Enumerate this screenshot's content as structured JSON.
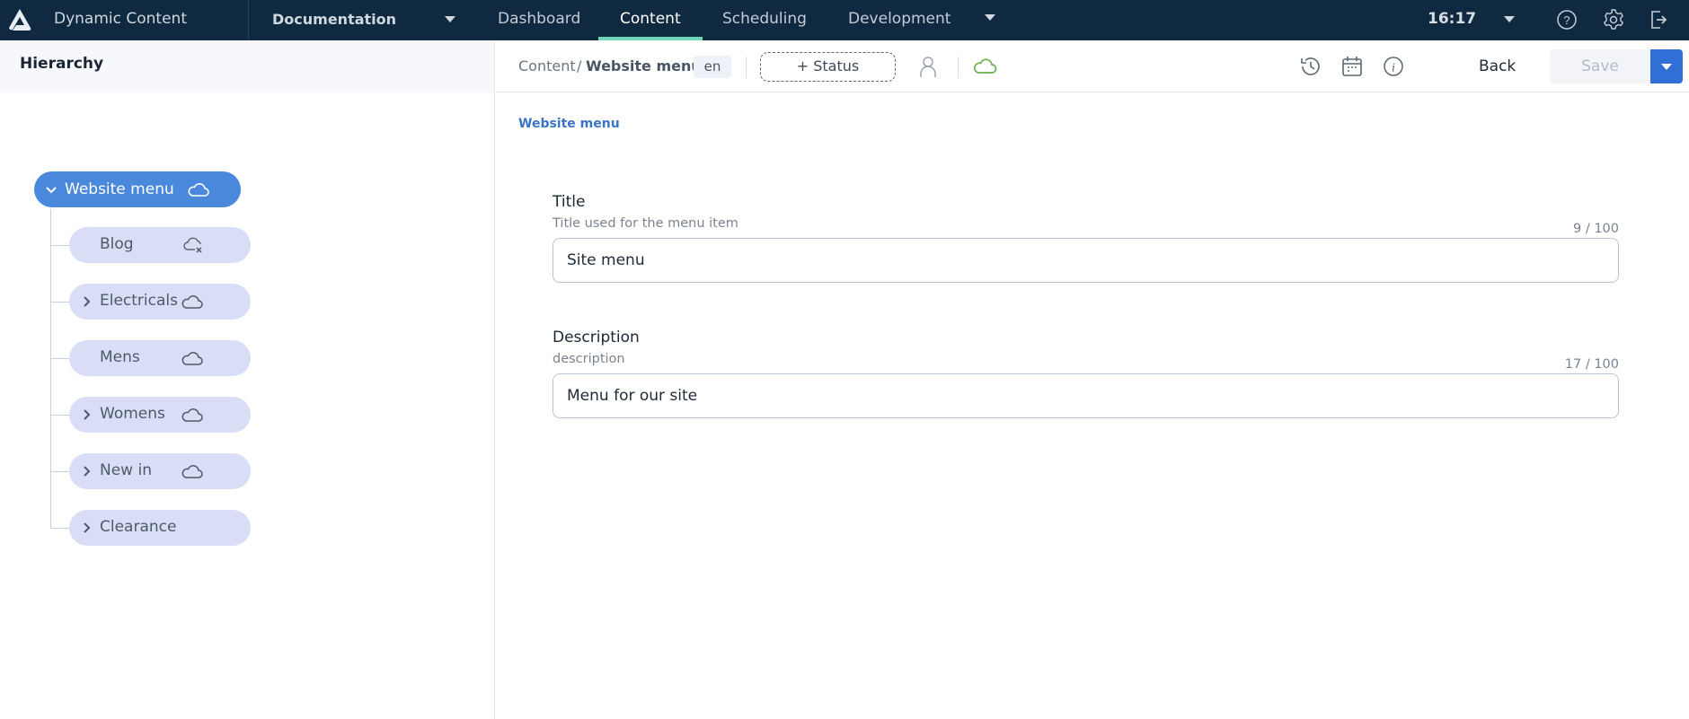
{
  "topbar": {
    "app_title": "Dynamic Content",
    "hub": "Documentation",
    "tabs": [
      {
        "label": "Dashboard",
        "active": false
      },
      {
        "label": "Content",
        "active": true
      },
      {
        "label": "Scheduling",
        "active": false
      },
      {
        "label": "Development",
        "active": false
      }
    ],
    "time": "16:17",
    "icons": [
      "help-icon",
      "settings-icon",
      "logout-icon"
    ],
    "accent": "#6fd8b8"
  },
  "sidebar": {
    "title": "Hierarchy",
    "root": {
      "label": "Website menu",
      "expanded": true,
      "status": "published"
    },
    "items": [
      {
        "label": "Blog",
        "has_children": false,
        "status": "unpublished"
      },
      {
        "label": "Electricals",
        "has_children": true,
        "status": "published"
      },
      {
        "label": "Mens",
        "has_children": false,
        "status": "published"
      },
      {
        "label": "Womens",
        "has_children": true,
        "status": "published"
      },
      {
        "label": "New in",
        "has_children": true,
        "status": "published"
      },
      {
        "label": "Clearance",
        "has_children": true,
        "status": "none"
      }
    ]
  },
  "toolbar": {
    "breadcrumb_root": "Content",
    "breadcrumb_sep": "/",
    "breadcrumb_current": "Website menu",
    "locale": "en",
    "status_button": "+ Status",
    "back_label": "Back",
    "save_label": "Save",
    "save_enabled": false
  },
  "content": {
    "heading": "Website menu",
    "fields": [
      {
        "label": "Title",
        "description": "Title used for the menu item",
        "count": "9 / 100",
        "value": "Site menu"
      },
      {
        "label": "Description",
        "description": "description",
        "count": "17 / 100",
        "value": "Menu for our site"
      }
    ]
  }
}
